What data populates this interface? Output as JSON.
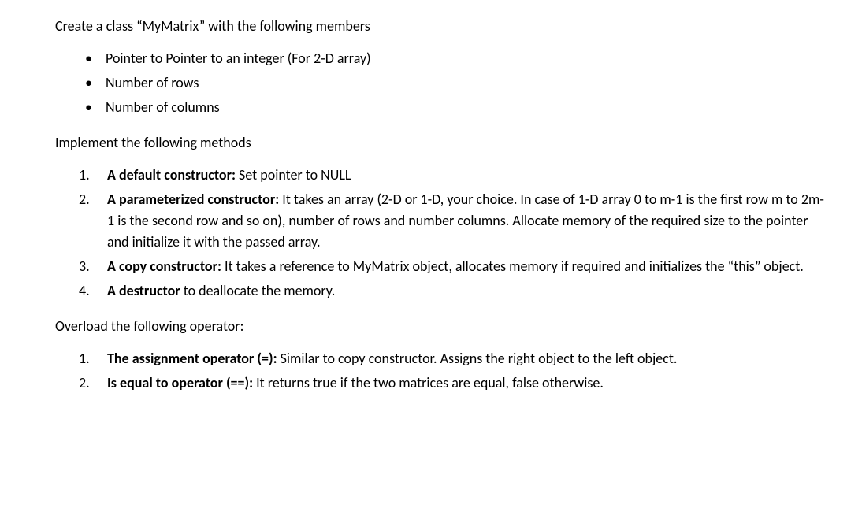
{
  "intro": "Create a class “MyMatrix” with the following members",
  "members": [
    "Pointer to Pointer to an integer (For 2-D array)",
    "Number of rows",
    "Number of columns"
  ],
  "methods_heading": "Implement the following methods",
  "methods": [
    {
      "num": "1.",
      "bold": "A default constructor: ",
      "rest": "Set pointer to NULL"
    },
    {
      "num": "2.",
      "bold": "A parameterized constructor: ",
      "rest": "It takes an array (2-D or 1-D, your choice. In case of 1-D array 0 to m-1 is the first row m to 2m-1 is the second row and so on), number of rows and number columns. Allocate memory of the required size to the pointer and initialize it with the passed array."
    },
    {
      "num": "3.",
      "bold": "A copy constructor: ",
      "rest": "It takes a reference to MyMatrix object, allocates memory if required and initializes the “this” object."
    },
    {
      "num": "4.",
      "bold": "A destructor ",
      "rest": "to deallocate the memory."
    }
  ],
  "overload_heading": "Overload the following operator:",
  "overloads": [
    {
      "num": "1.",
      "bold": "The assignment operator (=): ",
      "rest": "Similar to copy constructor. Assigns the right object to the left object."
    },
    {
      "num": "2.",
      "bold": "Is equal to operator (==): ",
      "rest": "It returns true if the two matrices are equal, false otherwise."
    }
  ]
}
